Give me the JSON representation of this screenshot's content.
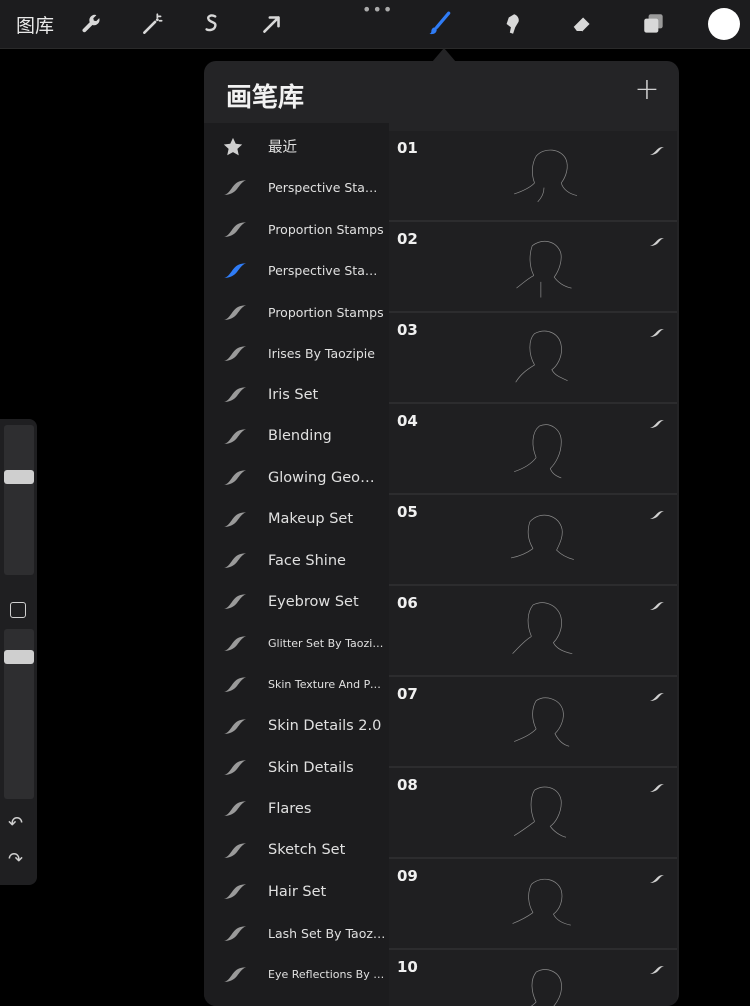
{
  "toolbar": {
    "gallery_label": "图库",
    "tools": [
      {
        "name": "wrench-icon"
      },
      {
        "name": "magic-wand-icon"
      },
      {
        "name": "selection-icon"
      },
      {
        "name": "transform-arrow-icon"
      },
      {
        "name": "brush-icon",
        "active": true
      },
      {
        "name": "smudge-icon"
      },
      {
        "name": "eraser-icon"
      },
      {
        "name": "layers-icon"
      }
    ],
    "more_label": "•••",
    "active_color": "#ffffff",
    "accent_color": "#2f7cf6"
  },
  "sidebar": {
    "undo_label": "↶",
    "redo_label": "↷"
  },
  "panel": {
    "title": "画笔库",
    "add_label": "+",
    "sets": [
      {
        "label": "最近",
        "icon": "star-icon"
      },
      {
        "label": "Perspective Stamps"
      },
      {
        "label": "Proportion Stamps"
      },
      {
        "label": "Perspective Stamps",
        "selected": true
      },
      {
        "label": "Proportion Stamps"
      },
      {
        "label": "Irises By Taozipie"
      },
      {
        "label": "Iris Set"
      },
      {
        "label": "Blending"
      },
      {
        "label": "Glowing Geometry"
      },
      {
        "label": "Makeup Set"
      },
      {
        "label": "Face Shine"
      },
      {
        "label": "Eyebrow Set"
      },
      {
        "label": "Glitter Set By Taozipie"
      },
      {
        "label": "Skin Texture And Pores"
      },
      {
        "label": "Skin Details 2.0"
      },
      {
        "label": "Skin Details"
      },
      {
        "label": "Flares"
      },
      {
        "label": "Sketch Set"
      },
      {
        "label": "Hair Set"
      },
      {
        "label": "Lash Set By Taozipie"
      },
      {
        "label": "Eye Reflections By Ta..."
      }
    ],
    "brushes": [
      {
        "label": "01"
      },
      {
        "label": "02"
      },
      {
        "label": "03"
      },
      {
        "label": "04"
      },
      {
        "label": "05"
      },
      {
        "label": "06"
      },
      {
        "label": "07"
      },
      {
        "label": "08"
      },
      {
        "label": "09"
      },
      {
        "label": "10"
      }
    ]
  }
}
